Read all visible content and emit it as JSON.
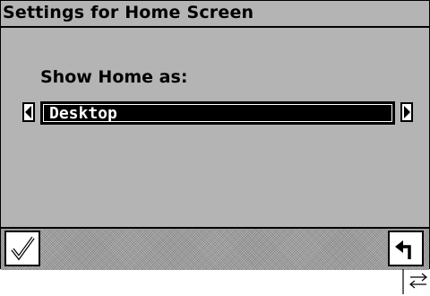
{
  "window": {
    "title": "Settings for Home Screen"
  },
  "form": {
    "label": "Show Home as:",
    "selected_value": "Desktop"
  },
  "icons": {
    "prev": "left-arrow-icon",
    "next": "right-arrow-icon",
    "ok": "checkmark-icon",
    "back": "back-arrow-icon",
    "switch": "swap-arrows-icon"
  },
  "colors": {
    "background": "#b4b4b4",
    "selection": "#000000",
    "selection_text": "#ffffff"
  }
}
